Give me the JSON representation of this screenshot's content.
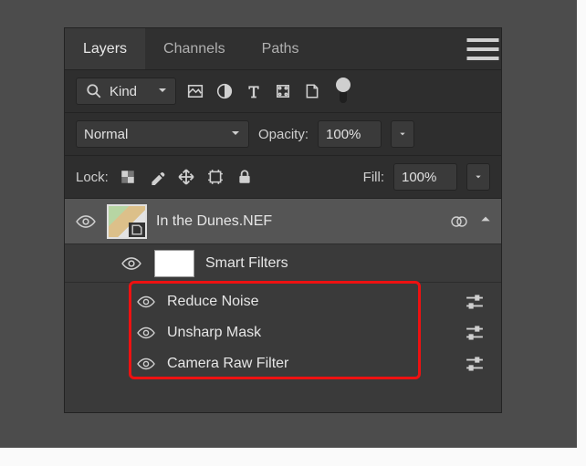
{
  "tabs": {
    "layers": "Layers",
    "channels": "Channels",
    "paths": "Paths"
  },
  "filterRow": {
    "kind": "Kind"
  },
  "blend": {
    "mode": "Normal",
    "opacityLabel": "Opacity:",
    "opacityValue": "100%"
  },
  "lock": {
    "label": "Lock:",
    "fillLabel": "Fill:",
    "fillValue": "100%"
  },
  "layer": {
    "name": "In the Dunes.NEF"
  },
  "smartFilters": {
    "label": "Smart Filters"
  },
  "filters": {
    "reduceNoise": "Reduce Noise",
    "unsharpMask": "Unsharp Mask",
    "cameraRaw": "Camera Raw Filter"
  }
}
